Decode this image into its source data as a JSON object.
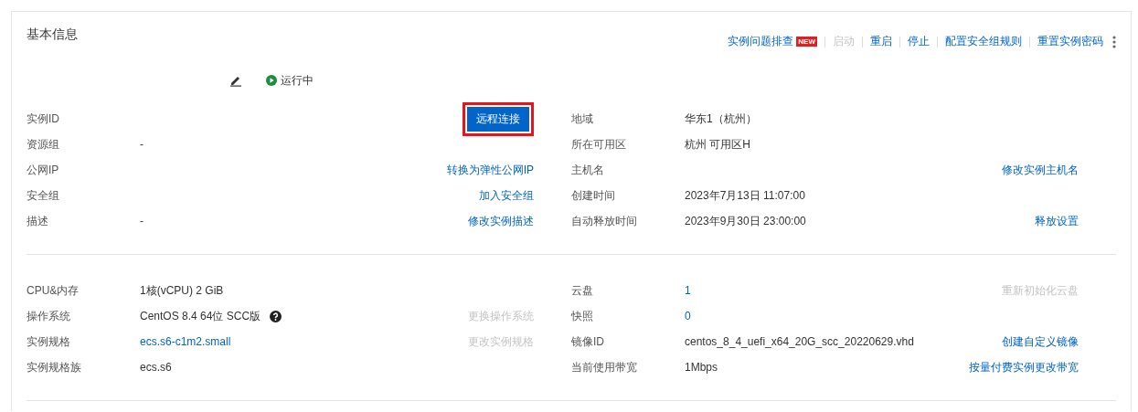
{
  "title": "基本信息",
  "actions": [
    {
      "label": "实例问题排查",
      "badge": "NEW",
      "disabled": false
    },
    {
      "label": "启动",
      "disabled": true
    },
    {
      "label": "重启",
      "disabled": false
    },
    {
      "label": "停止",
      "disabled": false
    },
    {
      "label": "配置安全组规则",
      "disabled": false
    },
    {
      "label": "重置实例密码",
      "disabled": false
    }
  ],
  "instance": {
    "status": "运行中",
    "kind": "running"
  },
  "sections": [
    {
      "left": [
        {
          "label": "实例ID",
          "action": {
            "label": "远程连接",
            "kind": "button",
            "disabled": false,
            "highlighted": true
          }
        },
        {
          "label": "资源组",
          "value": "-",
          "kind": "text"
        },
        {
          "label": "公网IP",
          "action": {
            "label": "转换为弹性公网IP",
            "kind": "link",
            "disabled": false
          }
        },
        {
          "label": "安全组",
          "action": {
            "label": "加入安全组",
            "kind": "link",
            "disabled": false
          }
        },
        {
          "label": "描述",
          "value": "-",
          "kind": "text",
          "action": {
            "label": "修改实例描述",
            "kind": "link",
            "disabled": false
          }
        }
      ],
      "right": [
        {
          "label": "地域",
          "value": "华东1（杭州）",
          "kind": "text"
        },
        {
          "label": "所在可用区",
          "value": "杭州 可用区H",
          "kind": "text"
        },
        {
          "label": "主机名",
          "action": {
            "label": "修改实例主机名",
            "kind": "link",
            "disabled": false
          }
        },
        {
          "label": "创建时间",
          "value": "2023年7月13日 11:07:00",
          "kind": "text"
        },
        {
          "label": "自动释放时间",
          "value": "2023年9月30日 23:00:00",
          "kind": "text",
          "action": {
            "label": "释放设置",
            "kind": "link",
            "disabled": false
          }
        }
      ]
    },
    {
      "left": [
        {
          "label": "CPU&内存",
          "value": "1核(vCPU) 2 GiB",
          "kind": "text"
        },
        {
          "label": "操作系统",
          "value": "CentOS 8.4 64位 SCC版",
          "kind": "text",
          "help": true,
          "action": {
            "label": "更换操作系统",
            "kind": "link",
            "disabled": true
          }
        },
        {
          "label": "实例规格",
          "value": "ecs.s6-c1m2.small",
          "kind": "link",
          "action": {
            "label": "更改实例规格",
            "kind": "link",
            "disabled": true
          }
        },
        {
          "label": "实例规格族",
          "value": "ecs.s6",
          "kind": "text"
        }
      ],
      "right": [
        {
          "label": "云盘",
          "value": "1",
          "kind": "link",
          "action": {
            "label": "重新初始化云盘",
            "kind": "link",
            "disabled": true
          }
        },
        {
          "label": "快照",
          "value": "0",
          "kind": "link"
        },
        {
          "label": "镜像ID",
          "value": "centos_8_4_uefi_x64_20G_scc_20220629.vhd",
          "kind": "text",
          "action": {
            "label": "创建自定义镜像",
            "kind": "link",
            "disabled": false
          }
        },
        {
          "label": "当前使用带宽",
          "value": "1Mbps",
          "kind": "text",
          "action": {
            "label": "按量付费实例更改带宽",
            "kind": "link",
            "disabled": false
          }
        }
      ]
    }
  ]
}
